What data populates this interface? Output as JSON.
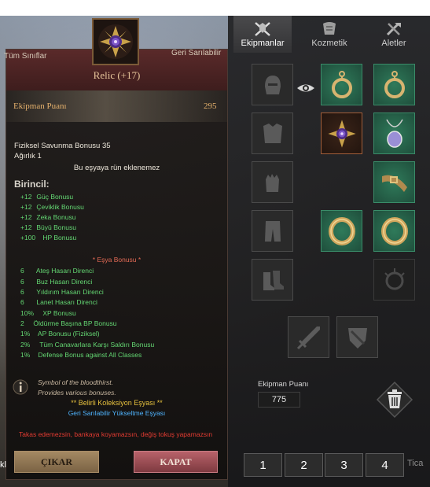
{
  "tooltip": {
    "class_left": "Tüm Sınıflar",
    "class_right": "Geri Sarılabilir",
    "item_name": "Relic (+17)",
    "equipment_points_label": "Ekipman Puanı",
    "equipment_points_value": "295",
    "physical_defense": "Fiziksel Savunma Bonusu 35",
    "weight": "Ağırlık 1",
    "rune_note": "Bu eşyaya rün eklenemez",
    "primary_heading": "Birincil:",
    "primary_stats": [
      {
        "value": "+12",
        "name": "Güç Bonusu"
      },
      {
        "value": "+12",
        "name": "Çeviklik Bonusu"
      },
      {
        "value": "+12",
        "name": "Zeka Bonusu"
      },
      {
        "value": "+12",
        "name": "Büyü Bonusu"
      },
      {
        "value": "+100",
        "name": "HP Bonusu"
      }
    ],
    "item_bonus_heading": "* Eşya Bonusu *",
    "item_bonuses": [
      {
        "value": "6",
        "name": "Ateş Hasarı Direnci"
      },
      {
        "value": "6",
        "name": "Buz Hasarı Direnci"
      },
      {
        "value": "6",
        "name": "Yıldırım Hasarı Direnci"
      },
      {
        "value": "6",
        "name": "Lanet Hasarı Direnci"
      },
      {
        "value": "10%",
        "name": "XP Bonusu"
      },
      {
        "value": "2",
        "name": "Öldürme Başına BP Bonusu"
      },
      {
        "value": "1%",
        "name": "AP Bonusu (Fiziksel)"
      },
      {
        "value": "2%",
        "name": "Tüm Canavarlara Karşı Saldırı Bonusu"
      },
      {
        "value": "1%",
        "name": "Defense Bonus against All Classes"
      }
    ],
    "flavor_line1": "Symbol of the bloodthirst.",
    "flavor_line2": "Provides various bonuses.",
    "collection_line": "** Belirli Koleksiyon Eşyası **",
    "rollback_line": "Geri Sarılabilir Yükseltme Eşyası",
    "warning": "Takas edemezsin, bankaya koyamazsın, değiş tokuş yapamazsın",
    "btn_remove": "ÇIKAR",
    "btn_close": "KAPAT",
    "left_fragment": "kl"
  },
  "panel": {
    "tabs": [
      {
        "label": "Ekipmanlar",
        "icon": "armor-icon",
        "active": true
      },
      {
        "label": "Kozmetik",
        "icon": "cosmetic-icon",
        "active": false
      },
      {
        "label": "Aletler",
        "icon": "tools-icon",
        "active": false
      }
    ],
    "equipment_points_label": "Ekipman Puanı",
    "equipment_points_value": "775",
    "pages": [
      "1",
      "2",
      "3",
      "4"
    ],
    "right_fragment": "Tica"
  },
  "colors": {
    "stat_green": "#64d873",
    "warning_red": "#e43b32",
    "collection_gold": "#e6c13e",
    "rollback_blue": "#4fb4ff",
    "slot_green": "#2f7a5a"
  }
}
